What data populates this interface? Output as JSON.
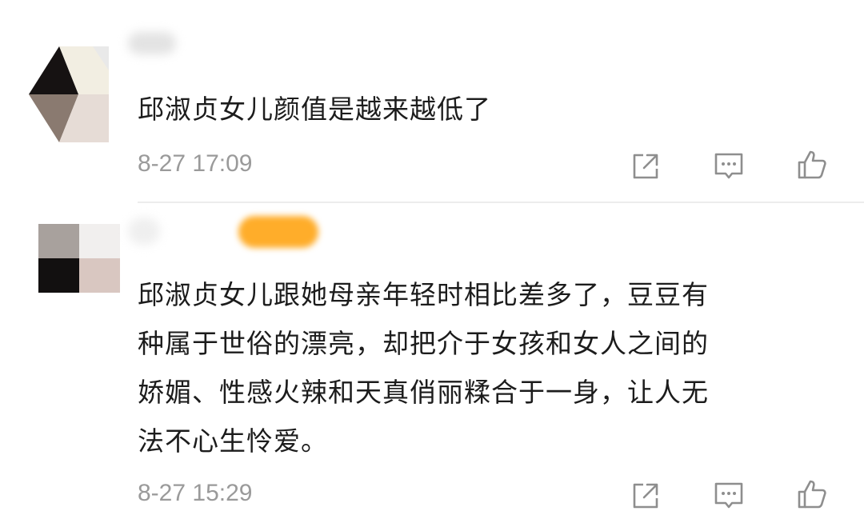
{
  "comments": [
    {
      "content_lines": [
        "邱淑贞女儿颜值是越来越低了"
      ],
      "time": "8-27 17:09",
      "actions": [
        "share-icon",
        "reply-icon",
        "like-icon"
      ]
    },
    {
      "content_lines": [
        "邱淑贞女儿跟她母亲年轻时相比差多了，豆豆有",
        "种属于世俗的漂亮，却把介于女孩和女人之间的",
        "娇媚、性感火辣和天真俏丽糅合于一身，让人无",
        "法不心生怜爱。"
      ],
      "time": "8-27 15:29",
      "actions": [
        "share-icon",
        "reply-icon",
        "like-icon"
      ]
    }
  ],
  "colors": {
    "text": "#1c1c1c",
    "meta": "#9a9a9a",
    "icon": "#8e8e8e",
    "divider": "#ececec",
    "accent_blur": "#ffad2a"
  }
}
